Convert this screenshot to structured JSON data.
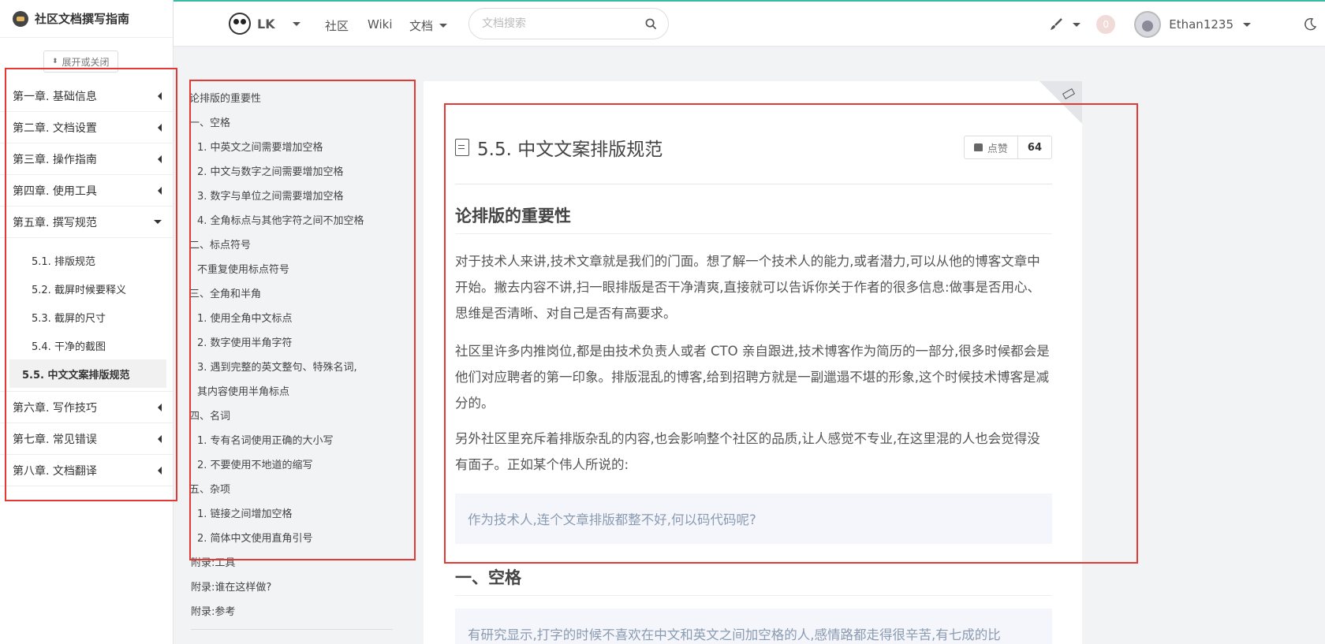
{
  "app": {
    "title": "社区文档撰写指南"
  },
  "sidebar": {
    "toggle_label": "展开或关闭",
    "chapters": [
      {
        "label": "第一章. 基础信息"
      },
      {
        "label": "第二章. 文档设置"
      },
      {
        "label": "第三章. 操作指南"
      },
      {
        "label": "第四章. 使用工具"
      },
      {
        "label": "第五章. 撰写规范"
      },
      {
        "label": "第六章. 写作技巧"
      },
      {
        "label": "第七章. 常见错误"
      },
      {
        "label": "第八章. 文档翻译"
      }
    ],
    "sub_items": [
      {
        "label": "5.1. 排版规范"
      },
      {
        "label": "5.2. 截屏时候要释义"
      },
      {
        "label": "5.3. 截屏的尺寸"
      },
      {
        "label": "5.4. 干净的截图"
      },
      {
        "label": "5.5. 中文文案排版规范",
        "active": true
      }
    ]
  },
  "topnav": {
    "brand": "LK",
    "links": [
      "社区",
      "Wiki",
      "文档"
    ],
    "search_placeholder": "文档搜索",
    "notification_count": "0",
    "username": "Ethan1235"
  },
  "toc": {
    "items": [
      {
        "label": "论排版的重要性",
        "level": 1
      },
      {
        "label": "一、空格",
        "level": 1
      },
      {
        "label": "1. 中英文之间需要增加空格",
        "level": 2
      },
      {
        "label": "2. 中文与数字之间需要增加空格",
        "level": 2
      },
      {
        "label": "3. 数字与单位之间需要增加空格",
        "level": 2
      },
      {
        "label": "4. 全角标点与其他字符之间不加空格",
        "level": 2
      },
      {
        "label": "二、标点符号",
        "level": 1
      },
      {
        "label": "不重复使用标点符号",
        "level": 2
      },
      {
        "label": "三、全角和半角",
        "level": 1
      },
      {
        "label": "1. 使用全角中文标点",
        "level": 2
      },
      {
        "label": "2. 数字使用半角字符",
        "level": 2
      },
      {
        "label": "3. 遇到完整的英文整句、特殊名词,",
        "level": 2
      },
      {
        "label": "其内容使用半角标点",
        "level": 2
      },
      {
        "label": "四、名词",
        "level": 1
      },
      {
        "label": "1. 专有名词使用正确的大小写",
        "level": 2
      },
      {
        "label": "2. 不要使用不地道的缩写",
        "level": 2
      },
      {
        "label": "五、杂项",
        "level": 1
      },
      {
        "label": "1. 链接之间增加空格",
        "level": 2
      },
      {
        "label": "2. 简体中文使用直角引号",
        "level": 2
      },
      {
        "label": "附录:工具",
        "level": 1
      },
      {
        "label": "附录:谁在这样做?",
        "level": 1
      },
      {
        "label": "附录:参考",
        "level": 1
      }
    ]
  },
  "article": {
    "title": "5.5. 中文文案排版规范",
    "like_label": "点赞",
    "like_count": "64",
    "section1_heading": "论排版的重要性",
    "p1": "对于技术人来讲,技术文章就是我们的门面。想了解一个技术人的能力,或者潜力,可以从他的博客文章中开始。撇去内容不讲,扫一眼排版是否干净清爽,直接就可以告诉你关于作者的很多信息:做事是否用心、思维是否清晰、对自己是否有高要求。",
    "p2": "社区里许多内推岗位,都是由技术负责人或者 CTO 亲自跟进,技术博客作为简历的一部分,很多时候都会是他们对应聘者的第一印象。排版混乱的博客,给到招聘方就是一副邋遢不堪的形象,这个时候技术博客是减分的。",
    "p3": "另外社区里充斥着排版杂乱的内容,也会影响整个社区的品质,让人感觉不专业,在这里混的人也会觉得没有面子。正如某个伟人所说的:",
    "quote1": "作为技术人,连个文章排版都整不好,何以码代码呢?",
    "section2_heading": "一、空格",
    "quote2": "有研究显示,打字的时候不喜欢在中文和英文之间加空格的人,感情路都走得很辛苦,有七成的比"
  }
}
